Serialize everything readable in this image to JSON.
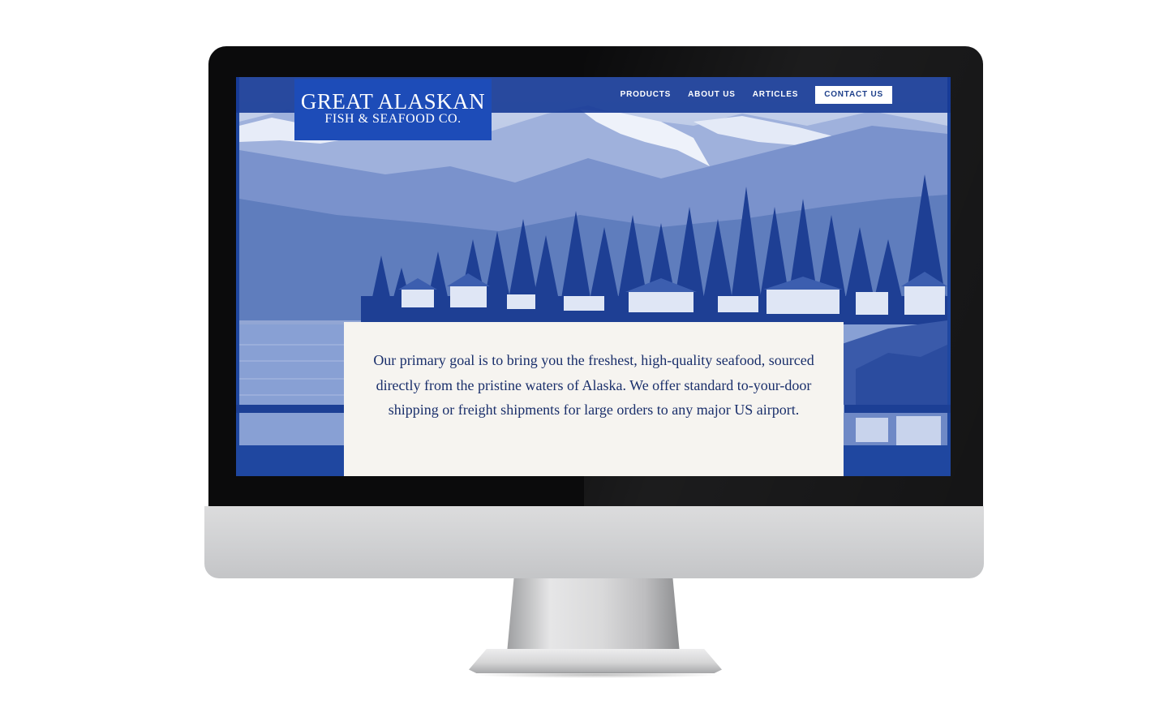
{
  "brand": {
    "line1": "GREAT ALASKAN",
    "line2": "FISH & SEAFOOD CO."
  },
  "nav": {
    "items": [
      "PRODUCTS",
      "ABOUT US",
      "ARTICLES"
    ],
    "contact_label": "CONTACT US"
  },
  "hero": {
    "image_description_icon": "alaska-landscape-image"
  },
  "intro": {
    "text": "Our primary goal is to bring you the freshest, high-quality seafood, sourced directly from the pristine waters of Alaska. We offer standard to-your-door shipping or freight shipments for large orders to any major US airport."
  },
  "colors": {
    "brand_blue": "#1d4cb8",
    "navbar_blue": "#163a96",
    "card_background": "#f6f4f0",
    "card_text": "#1a2f6b"
  }
}
